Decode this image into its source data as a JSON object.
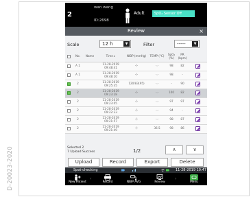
{
  "doc_code": "D-20023-2020",
  "status": {
    "bed": "2",
    "patient_name": "wan wang",
    "patient_id": "ID:2698",
    "patient_type": "Adult",
    "alarm_text": "SpO₂ Sensor Off",
    "alarm_color": "#49e0c6"
  },
  "dialog": {
    "title": "Review",
    "close": "×"
  },
  "filters": {
    "scale_label": "Scale",
    "scale_value": "12 h",
    "filter_label": "Filter",
    "filter_value": "-----"
  },
  "table": {
    "headers": [
      "",
      "No.",
      "Name",
      "Time↓",
      "NIBP (mmHg)",
      "TEMP (°C)",
      "SpO₂ (%)",
      "PR (bpm)",
      ""
    ],
    "rows": [
      {
        "checked": false,
        "flag": "A",
        "no": "1",
        "name": "",
        "date": "11-28-2019",
        "time": "09:48:41",
        "nibp": "-/-",
        "temp": "-.-",
        "spo2": "98",
        "pr": "82",
        "selected": false
      },
      {
        "checked": false,
        "flag": "A",
        "no": "1",
        "name": "",
        "date": "11-28-2019",
        "time": "09:48:10",
        "nibp": "-/-",
        "temp": "-.-",
        "spo2": "98",
        "pr": "-",
        "selected": false
      },
      {
        "checked": true,
        "flag": "",
        "no": "2",
        "name": "",
        "date": "11-28-2019",
        "time": "09:25:35",
        "nibp": "120/83(95)",
        "temp": "-.-",
        "spo2": "-",
        "pr": "90",
        "selected": false
      },
      {
        "checked": true,
        "flag": "",
        "no": "2",
        "name": "",
        "date": "11-28-2019",
        "time": "09:23:28",
        "nibp": "-/-",
        "temp": "-.-",
        "spo2": "100",
        "pr": "82",
        "selected": true
      },
      {
        "checked": false,
        "flag": "",
        "no": "2",
        "name": "",
        "date": "11-28-2019",
        "time": "09:23:05",
        "nibp": "-/-",
        "temp": "-.-",
        "spo2": "97",
        "pr": "97",
        "selected": false
      },
      {
        "checked": false,
        "flag": "",
        "no": "2",
        "name": "",
        "date": "11-28-2019",
        "time": "09:22:33",
        "nibp": "-/-",
        "temp": "-.-",
        "spo2": "94",
        "pr": "-",
        "selected": false
      },
      {
        "checked": false,
        "flag": "",
        "no": "2",
        "name": "",
        "date": "11-28-2019",
        "time": "09:21:57",
        "nibp": "-/-",
        "temp": "-.-",
        "spo2": "98",
        "pr": "87",
        "selected": false
      },
      {
        "checked": false,
        "flag": "",
        "no": "2",
        "name": "",
        "date": "11-28-2019",
        "time": "09:21:49",
        "nibp": "-/-",
        "temp": "36.5",
        "spo2": "98",
        "pr": "86",
        "selected": false
      }
    ]
  },
  "footer": {
    "selected_line": "Selected 2",
    "upload_line": "7 Upload Success",
    "page": "1/2",
    "up": "∧",
    "down": "∨"
  },
  "actions": {
    "upload": "Upload",
    "record": "Record",
    "export": "Export",
    "delete": "Delete"
  },
  "infobar": {
    "mode": "Spot-checking",
    "datetime": "11-28-2019 10:47"
  },
  "quick_keys": [
    {
      "label": "New Patient",
      "icon": "new-patient-icon"
    },
    {
      "label": "Record",
      "icon": "printer-icon"
    },
    {
      "label": "NIBP AVG",
      "icon": "nibp-cuff-icon"
    },
    {
      "label": "Review",
      "icon": "review-icon"
    },
    {
      "label": "Menu",
      "icon": "menu-icon"
    }
  ]
}
